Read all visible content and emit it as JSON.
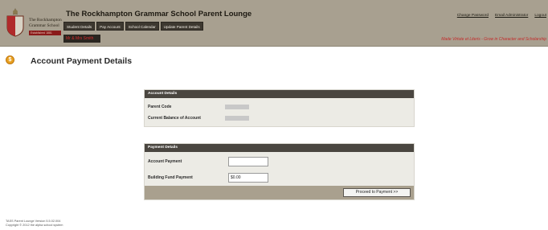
{
  "header": {
    "school_name_line1": "The Rockhampton",
    "school_name_line2": "Grammar School",
    "school_name_small": "Established 1881",
    "app_title": "The Rockhampton Grammar School Parent Lounge",
    "nav": [
      "Student Details",
      "Pay Account",
      "School Calendar",
      "Update Parent Details"
    ],
    "user_name": "Mr & Mrs Smith",
    "links": [
      "Change Password",
      "Email Administrator",
      "Logout"
    ],
    "motto": "Made Virtute et Literis - Grow in Character and Scholarship"
  },
  "page": {
    "title": "Account Payment Details",
    "icon": "dollar-coin-icon"
  },
  "account_details": {
    "heading": "Account Details",
    "parent_code_label": "Parent Code",
    "balance_label": "Current Balance of Account"
  },
  "payment_details": {
    "heading": "Payment Details",
    "account_payment_label": "Account Payment",
    "account_payment_value": "",
    "building_fund_label": "Building Fund Payment",
    "building_fund_value": "$0.00",
    "proceed_label": "Proceed to Payment >>"
  },
  "footer": {
    "version": "TASS Parent Lounge Version 5.5.02.004",
    "copyright": "Copyright © 2012 the alpha school system"
  },
  "colors": {
    "header_bg": "#a8a090",
    "nav_bg": "#3d3830",
    "panel_head_bg": "#4a4640",
    "motto": "#c42a2a"
  }
}
